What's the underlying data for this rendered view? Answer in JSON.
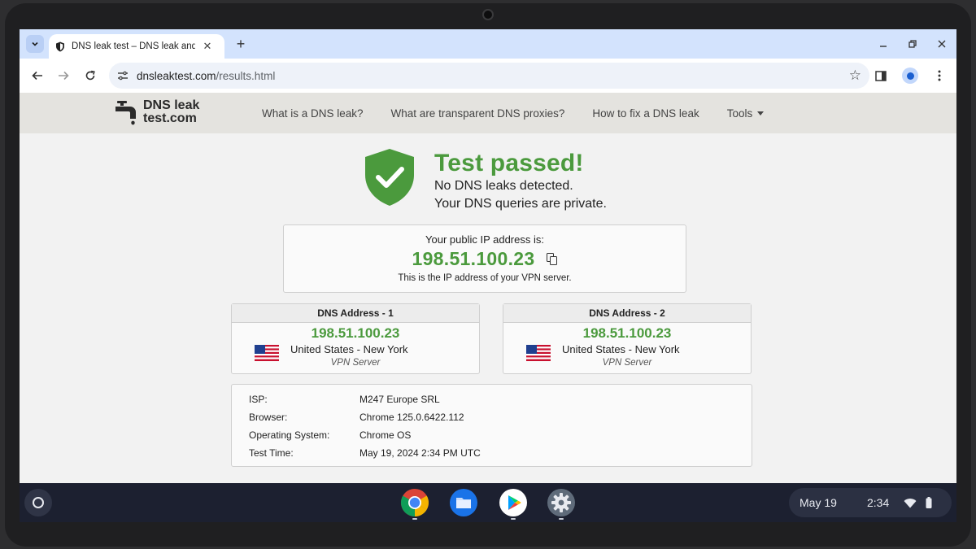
{
  "browser": {
    "tab": {
      "title": "DNS leak test – DNS leak and IP address test"
    },
    "url_host": "dnsleaktest.com",
    "url_path": "/results.html"
  },
  "site": {
    "logo_line1": "DNS leak",
    "logo_line2": "test.com",
    "nav": [
      "What is a DNS leak?",
      "What are transparent DNS proxies?",
      "How to fix a DNS leak",
      "Tools"
    ]
  },
  "result": {
    "status": "Test passed!",
    "line1": "No DNS leaks detected.",
    "line2": "Your DNS queries are private."
  },
  "public_ip": {
    "label": "Your public IP address is:",
    "value": "198.51.100.23",
    "note": "This is the IP address of your VPN server."
  },
  "dns": [
    {
      "heading": "DNS Address - 1",
      "ip": "198.51.100.23",
      "location": "United States - New York",
      "type": "VPN Server"
    },
    {
      "heading": "DNS Address - 2",
      "ip": "198.51.100.23",
      "location": "United States - New York",
      "type": "VPN Server"
    }
  ],
  "info": [
    {
      "key": "ISP:",
      "value": "M247 Europe SRL"
    },
    {
      "key": "Browser:",
      "value": "Chrome 125.0.6422.112"
    },
    {
      "key": "Operating System:",
      "value": "Chrome OS"
    },
    {
      "key": "Test Time:",
      "value": "May 19, 2024 2:34 PM UTC"
    }
  ],
  "shelf": {
    "apps": [
      "chrome-icon",
      "files-icon",
      "play-store-icon",
      "settings-icon"
    ],
    "date": "May 19",
    "time": "2:34"
  },
  "colors": {
    "accent_green": "#4b9a3d",
    "tabstrip": "#d3e3fd",
    "shelf": "#1c2030"
  }
}
